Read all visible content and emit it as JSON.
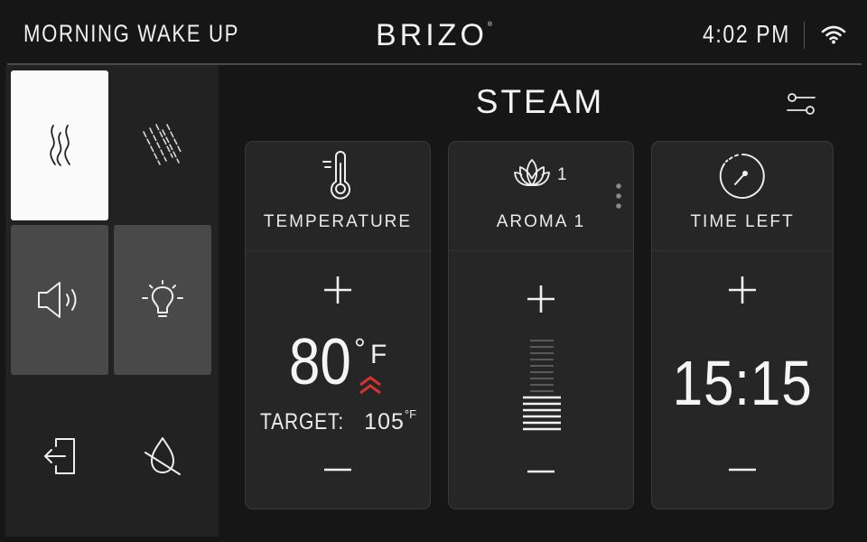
{
  "header": {
    "title": "MORNING WAKE UP",
    "logo": "BRIZO",
    "logo_mark": "®",
    "time": "4:02 PM",
    "wifi_icon": "wifi-icon"
  },
  "sidebar": {
    "tiles": [
      {
        "icon": "steam-icon",
        "selected": true
      },
      {
        "icon": "rain-icon",
        "selected": false
      },
      {
        "icon": "speaker-icon",
        "selected": false
      },
      {
        "icon": "lightbulb-icon",
        "selected": false
      },
      {
        "icon": "exit-icon",
        "selected": false
      },
      {
        "icon": "water-off-icon",
        "selected": false
      }
    ]
  },
  "main": {
    "section_title": "STEAM",
    "settings_icon": "settings-sliders-icon",
    "cards": {
      "temperature": {
        "label": "TEMPERATURE",
        "icon": "thermometer-icon",
        "value": "80",
        "degree": "°",
        "unit": "F",
        "target_label": "TARGET:",
        "target_value": "105",
        "target_unit": "°F",
        "trend_icon": "rising-arrows-icon"
      },
      "aroma": {
        "label": "AROMA 1",
        "icon": "lotus-icon",
        "icon_number": "1",
        "level_fraction": 0.4,
        "more_icon": "kebab-menu-icon"
      },
      "time": {
        "label": "TIME LEFT",
        "icon": "timer-icon",
        "value": "15:15"
      }
    }
  },
  "colors": {
    "background": "#161616",
    "card": "#262626",
    "selected_tile": "#fafafa",
    "inactive_tile": "#494949",
    "accent_red": "#d7332b",
    "text": "#ececec"
  }
}
